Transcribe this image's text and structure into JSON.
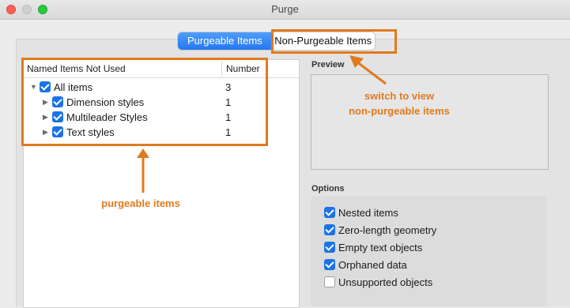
{
  "window": {
    "title": "Purge"
  },
  "tabs": [
    {
      "label": "Purgeable Items",
      "active": true
    },
    {
      "label": "Non-Purgeable Items",
      "active": false
    }
  ],
  "table": {
    "columns": [
      "Named Items Not Used",
      "Number"
    ],
    "rows": [
      {
        "label": "All items",
        "number": "3",
        "checked": true,
        "expanded": true
      },
      {
        "label": "Dimension styles",
        "number": "1",
        "checked": true
      },
      {
        "label": "Multileader Styles",
        "number": "1",
        "checked": true
      },
      {
        "label": "Text styles",
        "number": "1",
        "checked": true
      }
    ]
  },
  "preview": {
    "label": "Preview"
  },
  "options": {
    "label": "Options",
    "items": [
      {
        "label": "Nested items",
        "checked": true
      },
      {
        "label": "Zero-length geometry",
        "checked": true
      },
      {
        "label": "Empty text objects",
        "checked": true
      },
      {
        "label": "Orphaned data",
        "checked": true
      },
      {
        "label": "Unsupported objects",
        "checked": false
      }
    ]
  },
  "annotations": {
    "purgeable": "purgeable items",
    "switch_line1": "switch to view",
    "switch_line2": "non-purgeable items"
  },
  "colors": {
    "accent": "#1a73e8",
    "annotation": "#e07a1f",
    "tab_active": "#2677f2"
  }
}
